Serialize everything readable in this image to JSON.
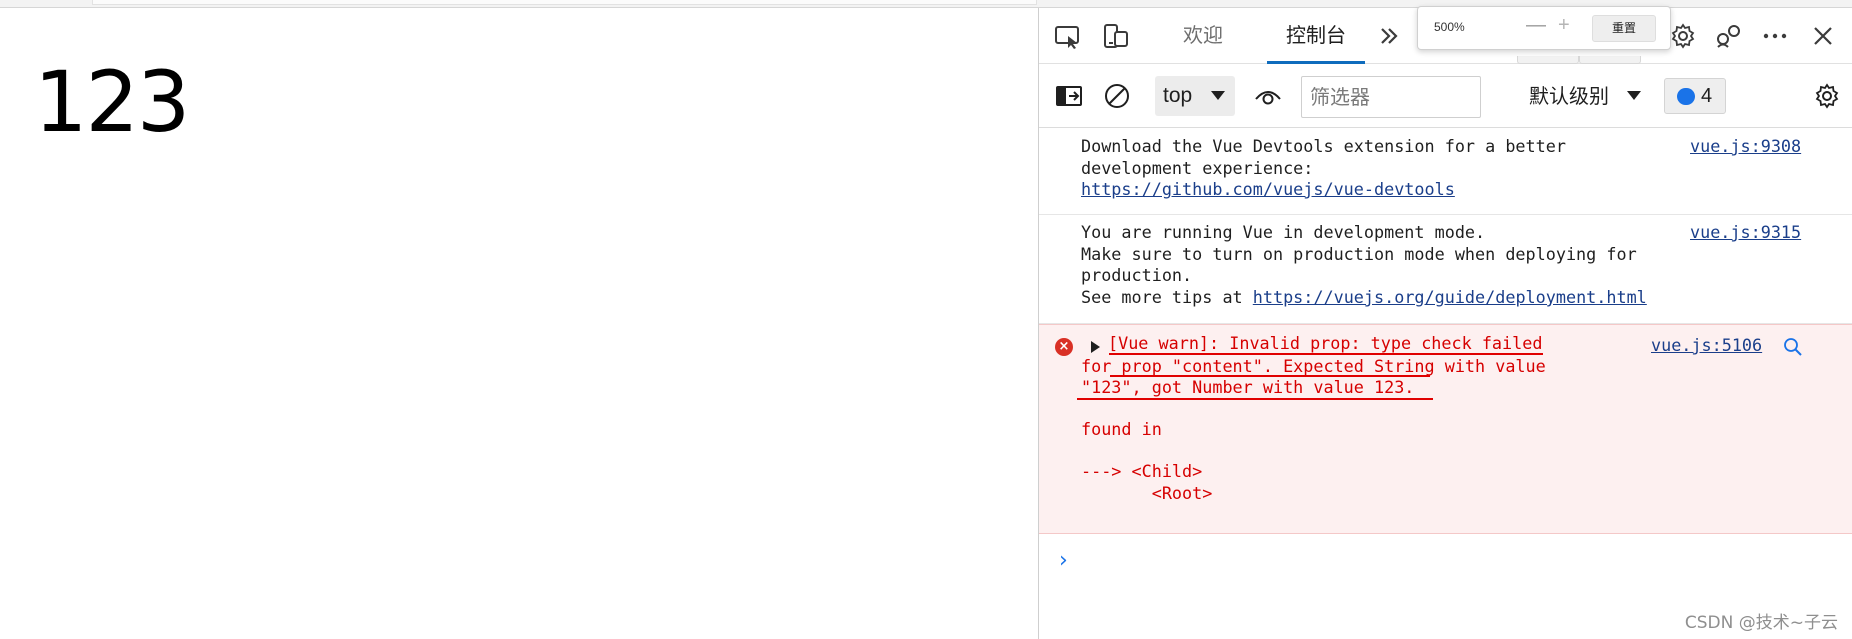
{
  "page": {
    "number_text": "123"
  },
  "devtools": {
    "tabs": [
      {
        "label": "欢迎",
        "active": false
      },
      {
        "label": "控制台",
        "active": true
      }
    ],
    "zoom": {
      "value": "500%",
      "minus": "—",
      "plus": "+",
      "reset_label": "重置"
    },
    "toolbar": {
      "context": "top",
      "filter_placeholder": "筛选器",
      "levels_label": "默认级别",
      "issues_count": "4"
    },
    "messages": [
      {
        "lines": [
          "Download the Vue Devtools extension for a better",
          "development experience:"
        ],
        "link": "https://github.com/vuejs/vue-devtools",
        "source": "vue.js:9308"
      },
      {
        "lines": [
          "You are running Vue in development mode.",
          "Make sure to turn on production mode when deploying for",
          "production."
        ],
        "tip_prefix": "See more tips at ",
        "link": "https://vuejs.org/guide/deployment.html",
        "source": "vue.js:9315"
      }
    ],
    "error": {
      "line1": "[Vue warn]: Invalid prop: type check failed",
      "line2": "for prop \"content\". Expected String with value",
      "line3": "\"123\", got Number with value 123.",
      "line4": "found in",
      "line5": "---> <Child>",
      "line6": "       <Root>",
      "source": "vue.js:5106"
    },
    "prompt_symbol": "›"
  },
  "watermark": "CSDN @技术~子云",
  "colors": {
    "accent": "#0f6cbd",
    "link": "#1a3e8a",
    "error_text": "#d60000",
    "error_bg": "#fdf0f0",
    "prompt": "#1a73e8"
  }
}
